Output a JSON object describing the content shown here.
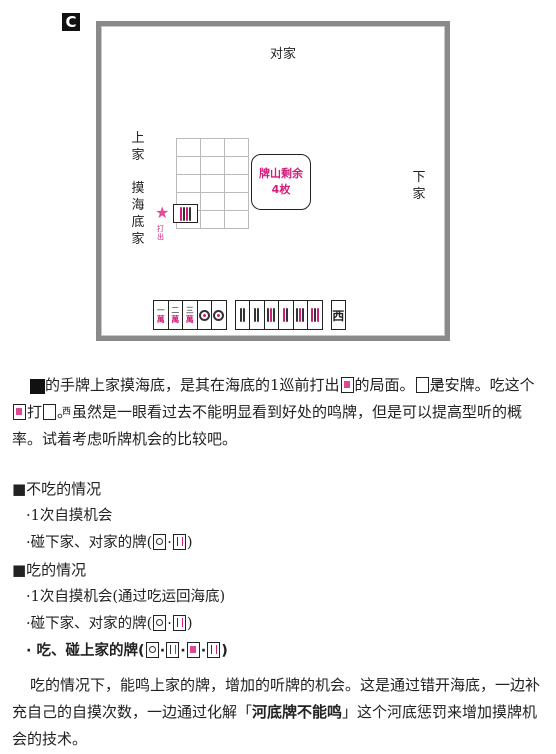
{
  "badge": "C",
  "board": {
    "seats": {
      "top": "对家",
      "left": [
        "上",
        "家"
      ],
      "left_draw": [
        "摸",
        "海",
        "底",
        "家"
      ],
      "right": [
        "下",
        "家"
      ]
    },
    "wall_count": [
      "牌山剩余",
      "4枚"
    ],
    "discard_label": [
      "打",
      "出"
    ],
    "hand_tiles": [
      "一万",
      "二万",
      "三万",
      "筒",
      "筒",
      "索",
      "索",
      "索",
      "索",
      "索",
      "索",
      "西"
    ]
  },
  "text": {
    "para1": "的手牌上家摸海底，是其在海底的1巡前打出",
    "para1_b": "的局面。",
    "para1_c": "是安牌。吃这个",
    "para1_d": "打",
    "para1_e": "。虽然是一眼看过去不能明显看到好处的鸣牌，但是可以提高型听的概率。试着考虑听牌机会的比较吧。",
    "h1": "■不吃的情况",
    "b1": "·1次自摸机会",
    "b2": "·碰下家、对家的牌(",
    "b2_end": ")",
    "h2": "■吃的情况",
    "b3": "·1次自摸机会(通过吃运回海底)",
    "b4": "·碰下家、对家的牌(",
    "b4_end": ")",
    "b5": "· 吃、碰上家的牌(",
    "b5_end": ")",
    "para2_a": "吃的情况下，能鸣上家的牌，增加的听牌的机会。这是通过错开海底，一边补充自己的自摸次数，一边通过化解「",
    "para2_strong": "河底牌不能鸣",
    "para2_b": "」这个河底惩罚来增加摸牌机会的技术。"
  }
}
